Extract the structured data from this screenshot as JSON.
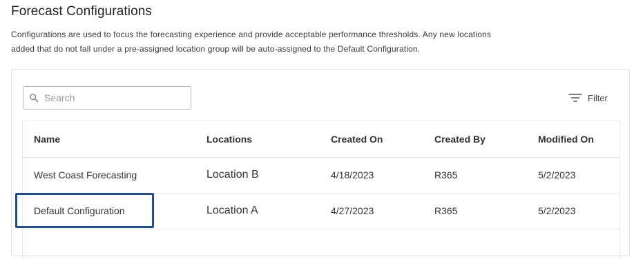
{
  "header": {
    "title": "Forecast Configurations",
    "description_line1": "Configurations are used to focus the forecasting experience and provide acceptable performance thresholds. Any new locations",
    "description_line2": "added that do not fall under a pre-assigned location group will be auto-assigned to the Default Configuration."
  },
  "search": {
    "placeholder": "Search",
    "value": "",
    "icon": "search-icon"
  },
  "filter": {
    "label": "Filter",
    "icon": "filter-icon"
  },
  "table": {
    "columns": [
      "Name",
      "Locations",
      "Created On",
      "Created By",
      "Modified On"
    ],
    "rows": [
      {
        "name": "West Coast Forecasting",
        "location": "Location B",
        "created_on": "4/18/2023",
        "created_by": "R365",
        "modified_on": "5/2/2023"
      },
      {
        "name": "Default Configuration",
        "location": "Location A",
        "created_on": "4/27/2023",
        "created_by": "R365",
        "modified_on": "5/2/2023"
      }
    ]
  },
  "colors": {
    "link": "#2a74b3",
    "highlight": "#1f4e94",
    "border": "#e2e2e2"
  }
}
